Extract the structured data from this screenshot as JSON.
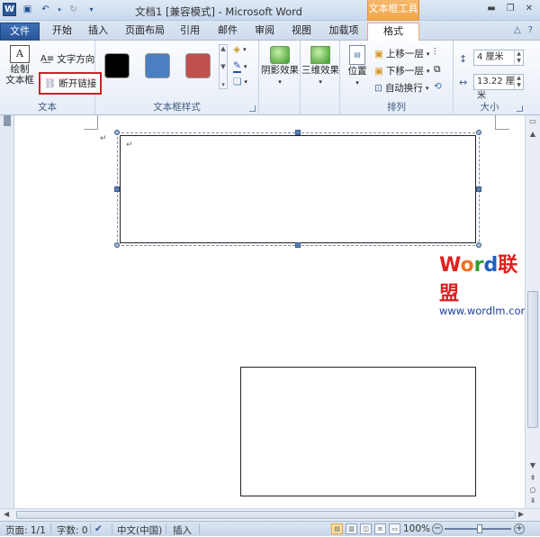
{
  "window": {
    "title": "文档1 [兼容模式] - Microsoft Word",
    "context_tab_header": "文本框工具"
  },
  "tabs": {
    "file": "文件",
    "items": [
      "开始",
      "插入",
      "页面布局",
      "引用",
      "邮件",
      "审阅",
      "视图",
      "加载项"
    ],
    "format": "格式"
  },
  "ribbon": {
    "text_group": {
      "draw_textbox": "绘制\n文本框",
      "text_direction": "文字方向",
      "break_link": "断开链接",
      "label": "文本"
    },
    "style_group": {
      "label": "文本框样式",
      "swatches": [
        "#000000",
        "#4a7fc1",
        "#c0504d"
      ]
    },
    "shadow_group": {
      "shadow_effect": "阴影效果"
    },
    "threed_group": {
      "threed_effect": "三维效果"
    },
    "arrange_group": {
      "position": "位置",
      "bring_forward": "上移一层",
      "send_backward": "下移一层",
      "text_wrap": "自动换行",
      "label": "排列"
    },
    "size_group": {
      "height": "4 厘米",
      "width": "13.22 厘米",
      "label": "大小"
    }
  },
  "document": {
    "paragraph_mark": "↵",
    "watermark_brand": "Word联盟",
    "watermark_url": "www.wordlm.com"
  },
  "statusbar": {
    "page": "页面: 1/1",
    "words": "字数: 0",
    "language": "中文(中国)",
    "mode": "插入",
    "zoom": "100%"
  }
}
